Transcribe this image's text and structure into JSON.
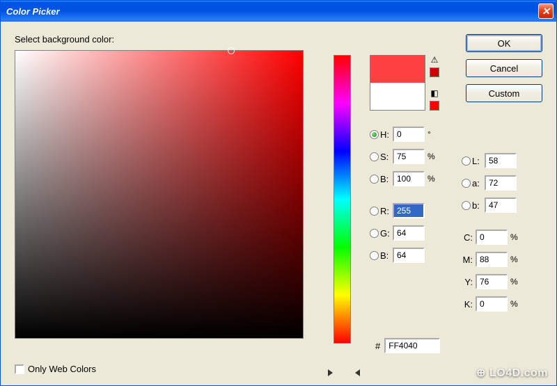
{
  "window": {
    "title": "Color Picker",
    "close_symbol": "✕"
  },
  "prompt": "Select background color:",
  "buttons": {
    "ok": "OK",
    "cancel": "Cancel",
    "custom": "Custom"
  },
  "swatch": {
    "new_color": "#FF4040",
    "old_color": "#FFFFFF",
    "warn_swatch": "#D00000",
    "cube_swatch": "#FF0000"
  },
  "hsb": {
    "h_label": "H:",
    "h_value": "0",
    "h_unit": "°",
    "s_label": "S:",
    "s_value": "75",
    "s_unit": "%",
    "b_label": "B:",
    "b_value": "100",
    "b_unit": "%"
  },
  "lab": {
    "l_label": "L:",
    "l_value": "58",
    "a_label": "a:",
    "a_value": "72",
    "b_label": "b:",
    "b_value": "47"
  },
  "rgb": {
    "r_label": "R:",
    "r_value": "255",
    "g_label": "G:",
    "g_value": "64",
    "b_label": "B:",
    "b_value": "64"
  },
  "cmyk": {
    "c_label": "C:",
    "c_value": "0",
    "c_unit": "%",
    "m_label": "M:",
    "m_value": "88",
    "m_unit": "%",
    "y_label": "Y:",
    "y_value": "76",
    "y_unit": "%",
    "k_label": "K:",
    "k_value": "0",
    "k_unit": "%"
  },
  "hex": {
    "label": "#",
    "value": "FF4040"
  },
  "webcolors": {
    "label": "Only Web Colors",
    "checked": false
  },
  "watermark": "⊕ LO4D.com"
}
